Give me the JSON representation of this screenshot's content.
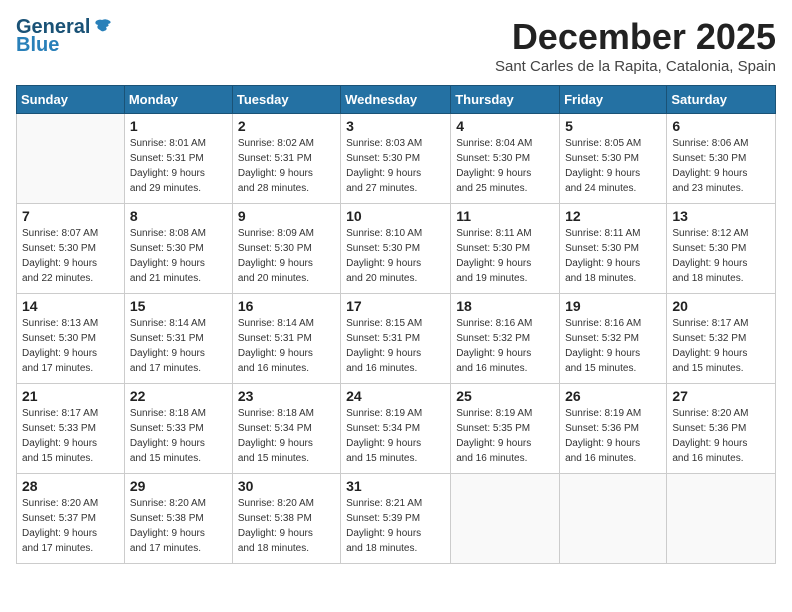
{
  "header": {
    "logo_line1": "General",
    "logo_line2": "Blue",
    "month_title": "December 2025",
    "subtitle": "Sant Carles de la Rapita, Catalonia, Spain"
  },
  "days_of_week": [
    "Sunday",
    "Monday",
    "Tuesday",
    "Wednesday",
    "Thursday",
    "Friday",
    "Saturday"
  ],
  "weeks": [
    [
      {
        "day": "",
        "info": ""
      },
      {
        "day": "1",
        "info": "Sunrise: 8:01 AM\nSunset: 5:31 PM\nDaylight: 9 hours\nand 29 minutes."
      },
      {
        "day": "2",
        "info": "Sunrise: 8:02 AM\nSunset: 5:31 PM\nDaylight: 9 hours\nand 28 minutes."
      },
      {
        "day": "3",
        "info": "Sunrise: 8:03 AM\nSunset: 5:30 PM\nDaylight: 9 hours\nand 27 minutes."
      },
      {
        "day": "4",
        "info": "Sunrise: 8:04 AM\nSunset: 5:30 PM\nDaylight: 9 hours\nand 25 minutes."
      },
      {
        "day": "5",
        "info": "Sunrise: 8:05 AM\nSunset: 5:30 PM\nDaylight: 9 hours\nand 24 minutes."
      },
      {
        "day": "6",
        "info": "Sunrise: 8:06 AM\nSunset: 5:30 PM\nDaylight: 9 hours\nand 23 minutes."
      }
    ],
    [
      {
        "day": "7",
        "info": "Sunrise: 8:07 AM\nSunset: 5:30 PM\nDaylight: 9 hours\nand 22 minutes."
      },
      {
        "day": "8",
        "info": "Sunrise: 8:08 AM\nSunset: 5:30 PM\nDaylight: 9 hours\nand 21 minutes."
      },
      {
        "day": "9",
        "info": "Sunrise: 8:09 AM\nSunset: 5:30 PM\nDaylight: 9 hours\nand 20 minutes."
      },
      {
        "day": "10",
        "info": "Sunrise: 8:10 AM\nSunset: 5:30 PM\nDaylight: 9 hours\nand 20 minutes."
      },
      {
        "day": "11",
        "info": "Sunrise: 8:11 AM\nSunset: 5:30 PM\nDaylight: 9 hours\nand 19 minutes."
      },
      {
        "day": "12",
        "info": "Sunrise: 8:11 AM\nSunset: 5:30 PM\nDaylight: 9 hours\nand 18 minutes."
      },
      {
        "day": "13",
        "info": "Sunrise: 8:12 AM\nSunset: 5:30 PM\nDaylight: 9 hours\nand 18 minutes."
      }
    ],
    [
      {
        "day": "14",
        "info": "Sunrise: 8:13 AM\nSunset: 5:30 PM\nDaylight: 9 hours\nand 17 minutes."
      },
      {
        "day": "15",
        "info": "Sunrise: 8:14 AM\nSunset: 5:31 PM\nDaylight: 9 hours\nand 17 minutes."
      },
      {
        "day": "16",
        "info": "Sunrise: 8:14 AM\nSunset: 5:31 PM\nDaylight: 9 hours\nand 16 minutes."
      },
      {
        "day": "17",
        "info": "Sunrise: 8:15 AM\nSunset: 5:31 PM\nDaylight: 9 hours\nand 16 minutes."
      },
      {
        "day": "18",
        "info": "Sunrise: 8:16 AM\nSunset: 5:32 PM\nDaylight: 9 hours\nand 16 minutes."
      },
      {
        "day": "19",
        "info": "Sunrise: 8:16 AM\nSunset: 5:32 PM\nDaylight: 9 hours\nand 15 minutes."
      },
      {
        "day": "20",
        "info": "Sunrise: 8:17 AM\nSunset: 5:32 PM\nDaylight: 9 hours\nand 15 minutes."
      }
    ],
    [
      {
        "day": "21",
        "info": "Sunrise: 8:17 AM\nSunset: 5:33 PM\nDaylight: 9 hours\nand 15 minutes."
      },
      {
        "day": "22",
        "info": "Sunrise: 8:18 AM\nSunset: 5:33 PM\nDaylight: 9 hours\nand 15 minutes."
      },
      {
        "day": "23",
        "info": "Sunrise: 8:18 AM\nSunset: 5:34 PM\nDaylight: 9 hours\nand 15 minutes."
      },
      {
        "day": "24",
        "info": "Sunrise: 8:19 AM\nSunset: 5:34 PM\nDaylight: 9 hours\nand 15 minutes."
      },
      {
        "day": "25",
        "info": "Sunrise: 8:19 AM\nSunset: 5:35 PM\nDaylight: 9 hours\nand 16 minutes."
      },
      {
        "day": "26",
        "info": "Sunrise: 8:19 AM\nSunset: 5:36 PM\nDaylight: 9 hours\nand 16 minutes."
      },
      {
        "day": "27",
        "info": "Sunrise: 8:20 AM\nSunset: 5:36 PM\nDaylight: 9 hours\nand 16 minutes."
      }
    ],
    [
      {
        "day": "28",
        "info": "Sunrise: 8:20 AM\nSunset: 5:37 PM\nDaylight: 9 hours\nand 17 minutes."
      },
      {
        "day": "29",
        "info": "Sunrise: 8:20 AM\nSunset: 5:38 PM\nDaylight: 9 hours\nand 17 minutes."
      },
      {
        "day": "30",
        "info": "Sunrise: 8:20 AM\nSunset: 5:38 PM\nDaylight: 9 hours\nand 18 minutes."
      },
      {
        "day": "31",
        "info": "Sunrise: 8:21 AM\nSunset: 5:39 PM\nDaylight: 9 hours\nand 18 minutes."
      },
      {
        "day": "",
        "info": ""
      },
      {
        "day": "",
        "info": ""
      },
      {
        "day": "",
        "info": ""
      }
    ]
  ]
}
